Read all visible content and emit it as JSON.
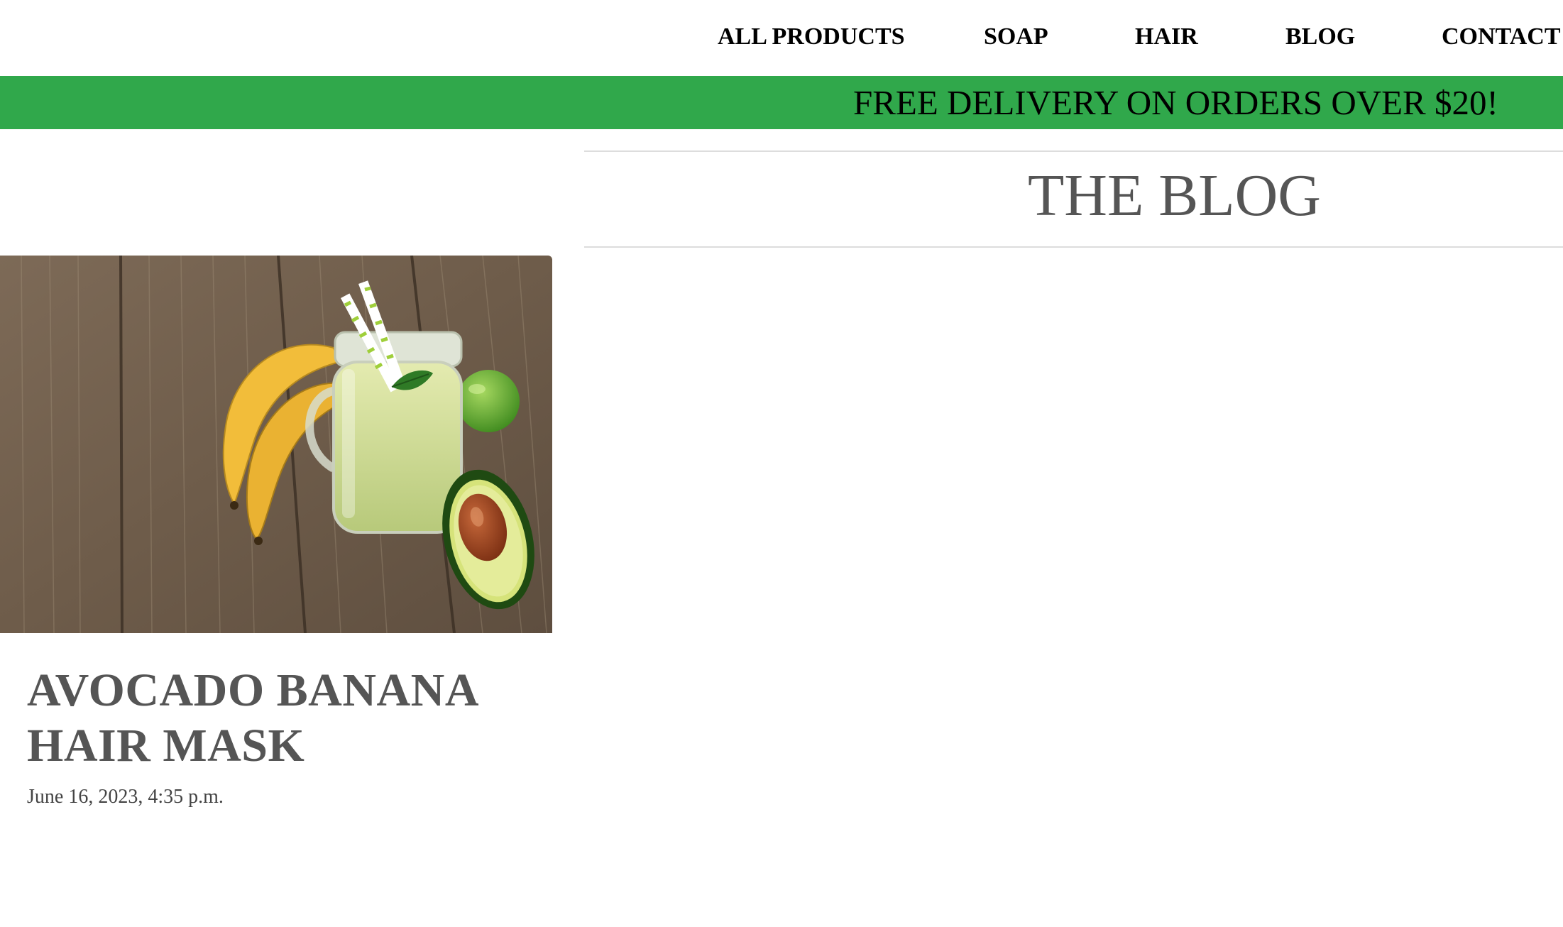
{
  "nav": {
    "items": [
      {
        "label": "ALL PRODUCTS"
      },
      {
        "label": "SOAP"
      },
      {
        "label": "HAIR"
      },
      {
        "label": "BLOG"
      },
      {
        "label": "CONTACT US"
      }
    ]
  },
  "promo": {
    "text": "FREE DELIVERY ON ORDERS OVER $20!",
    "color": "#30a84b"
  },
  "blog": {
    "title": "THE BLOG"
  },
  "posts": [
    {
      "title": "AVOCADO BANANA HAIR MASK",
      "date": "June 16, 2023, 4:35 p.m."
    }
  ],
  "colors": {
    "text_dark": "#000000",
    "text_muted": "#555555",
    "promo_green": "#30a84b"
  }
}
